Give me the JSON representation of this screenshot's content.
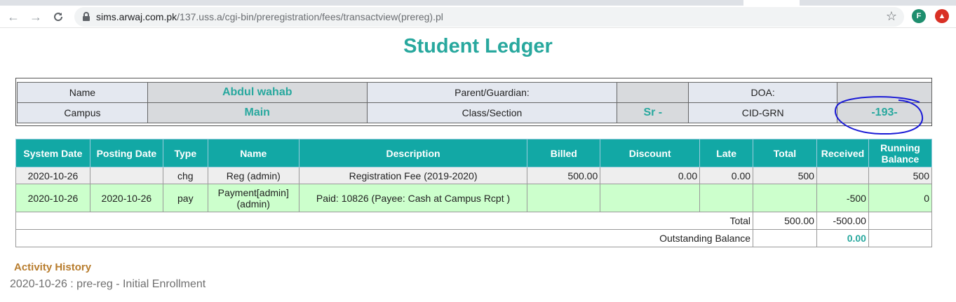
{
  "browser": {
    "url_host": "sims.arwaj.com.pk",
    "url_path": "/137.uss.a/cgi-bin/preregistration/fees/transactview(prereg).pl",
    "profile_initial": "F",
    "icons": [
      "back-arrow-icon",
      "forward-arrow-icon",
      "reload-icon",
      "lock-icon",
      "star-icon",
      "extension-icon"
    ]
  },
  "page": {
    "title": "Student Ledger"
  },
  "info": {
    "name_label": "Name",
    "name_value": "Abdul wahab",
    "parent_label": "Parent/Guardian:",
    "parent_value": "",
    "doa_label": "DOA:",
    "doa_value": "",
    "campus_label": "Campus",
    "campus_value": "Main",
    "class_label": "Class/Section",
    "class_value": "Sr -",
    "cid_label": "CID-GRN",
    "cid_value": "-193-"
  },
  "ledger": {
    "headers": {
      "system_date": "System Date",
      "posting_date": "Posting Date",
      "type": "Type",
      "name": "Name",
      "description": "Description",
      "billed": "Billed",
      "discount": "Discount",
      "late": "Late",
      "total": "Total",
      "received": "Received",
      "running_balance": "Running Balance"
    },
    "rows": [
      {
        "system_date": "2020-10-26",
        "posting_date": "",
        "type": "chg",
        "name": "Reg (admin)",
        "description": "Registration Fee (2019-2020)",
        "billed": "500.00",
        "discount": "0.00",
        "late": "0.00",
        "total": "500",
        "received": "",
        "running_balance": "500"
      },
      {
        "system_date": "2020-10-26",
        "posting_date": "2020-10-26",
        "type": "pay",
        "name": "Payment[admin] (admin)",
        "description": "Paid: 10826 (Payee: Cash at Campus Rcpt )",
        "billed": "",
        "discount": "",
        "late": "",
        "total": "",
        "received": "-500",
        "running_balance": "0"
      }
    ],
    "total_label": "Total",
    "total_amount": "500.00",
    "total_received": "-500.00",
    "outstanding_label": "Outstanding Balance",
    "outstanding_value": "0.00"
  },
  "activity": {
    "title": "Activity History",
    "items": [
      "2020-10-26 : pre-reg - Initial Enrollment"
    ]
  },
  "colors": {
    "accent": "#28a89e",
    "header_bg": "#12a8a5",
    "payment_row": "#ccffcc",
    "activity_title": "#b87d2e",
    "annotation_circle": "#1a1ad6"
  }
}
